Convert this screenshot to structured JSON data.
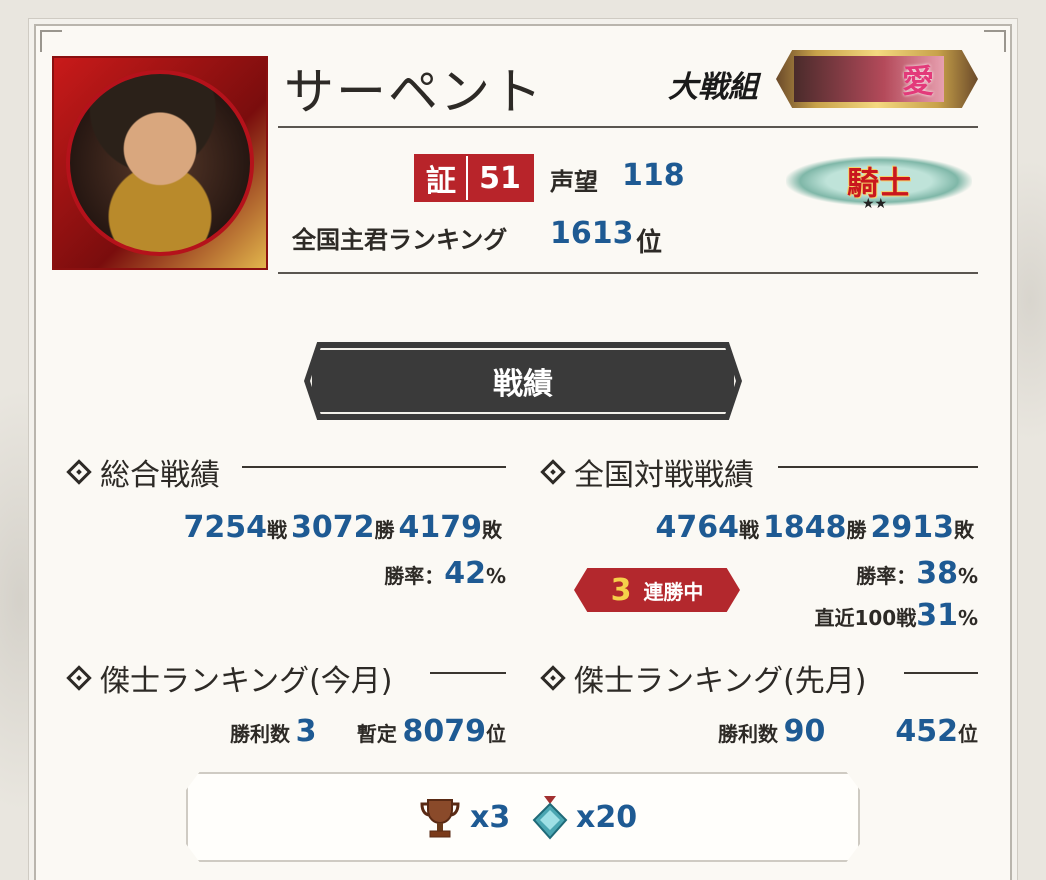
{
  "player": {
    "name": "サーペント",
    "group_label": "大戦組",
    "group_banner_text": "愛",
    "rank_title": "騎士",
    "rank_stars": "★★"
  },
  "badge": {
    "label": "証",
    "value": "51"
  },
  "prestige": {
    "label": "声望",
    "value": "118"
  },
  "national_ranking": {
    "label": "全国主君ランキング",
    "value": "1613",
    "unit": "位"
  },
  "section_title": "戦績",
  "overall": {
    "heading": "総合戦績",
    "battles": "7254",
    "battles_unit": "戦",
    "wins": "3072",
    "wins_unit": "勝",
    "losses": "4179",
    "losses_unit": "敗",
    "win_rate_label": "勝率：",
    "win_rate": "42",
    "win_rate_unit": "%"
  },
  "national": {
    "heading": "全国対戦戦績",
    "battles": "4764",
    "battles_unit": "戦",
    "wins": "1848",
    "wins_unit": "勝",
    "losses": "2913",
    "losses_unit": "敗",
    "win_rate_label": "勝率：",
    "win_rate": "38",
    "win_rate_unit": "%",
    "recent_label": "直近100戦",
    "recent_rate": "31",
    "recent_unit": "%",
    "streak_count": "3",
    "streak_label": "連勝中"
  },
  "hero_rank_this_month": {
    "heading": "傑士ランキング(今月)",
    "wins_label": "勝利数",
    "wins": "3",
    "provisional_label": "暫定",
    "rank": "8079",
    "rank_unit": "位"
  },
  "hero_rank_last_month": {
    "heading": "傑士ランキング(先月)",
    "wins_label": "勝利数",
    "wins": "90",
    "rank": "452",
    "rank_unit": "位"
  },
  "trophies": {
    "trophy_count": "x3",
    "gem_count": "x20"
  },
  "colors": {
    "accent_blue": "#1e5a93",
    "accent_red": "#b8242a",
    "panel": "#fbf9f4"
  }
}
